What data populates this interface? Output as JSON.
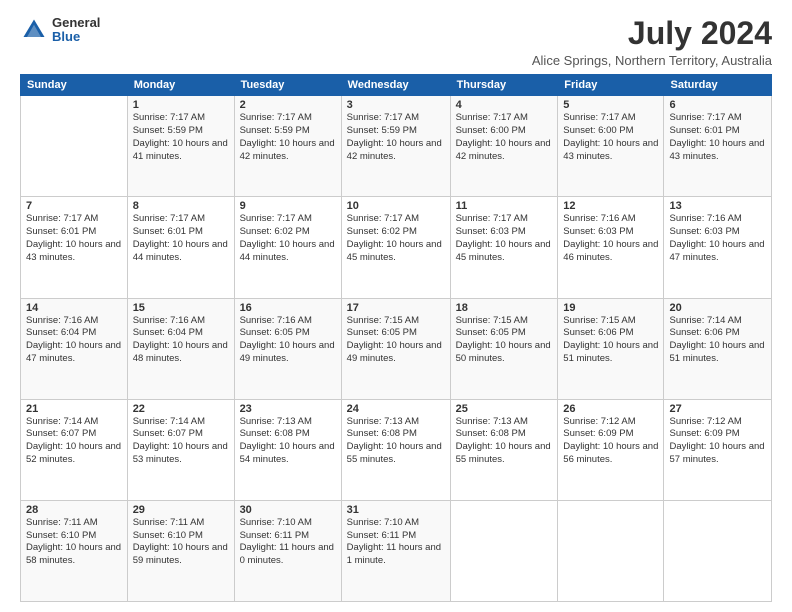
{
  "logo": {
    "general": "General",
    "blue": "Blue"
  },
  "title": "July 2024",
  "location": "Alice Springs, Northern Territory, Australia",
  "days_header": [
    "Sunday",
    "Monday",
    "Tuesday",
    "Wednesday",
    "Thursday",
    "Friday",
    "Saturday"
  ],
  "weeks": [
    [
      {
        "day": "",
        "sunrise": "",
        "sunset": "",
        "daylight": ""
      },
      {
        "day": "1",
        "sunrise": "Sunrise: 7:17 AM",
        "sunset": "Sunset: 5:59 PM",
        "daylight": "Daylight: 10 hours and 41 minutes."
      },
      {
        "day": "2",
        "sunrise": "Sunrise: 7:17 AM",
        "sunset": "Sunset: 5:59 PM",
        "daylight": "Daylight: 10 hours and 42 minutes."
      },
      {
        "day": "3",
        "sunrise": "Sunrise: 7:17 AM",
        "sunset": "Sunset: 5:59 PM",
        "daylight": "Daylight: 10 hours and 42 minutes."
      },
      {
        "day": "4",
        "sunrise": "Sunrise: 7:17 AM",
        "sunset": "Sunset: 6:00 PM",
        "daylight": "Daylight: 10 hours and 42 minutes."
      },
      {
        "day": "5",
        "sunrise": "Sunrise: 7:17 AM",
        "sunset": "Sunset: 6:00 PM",
        "daylight": "Daylight: 10 hours and 43 minutes."
      },
      {
        "day": "6",
        "sunrise": "Sunrise: 7:17 AM",
        "sunset": "Sunset: 6:01 PM",
        "daylight": "Daylight: 10 hours and 43 minutes."
      }
    ],
    [
      {
        "day": "7",
        "sunrise": "Sunrise: 7:17 AM",
        "sunset": "Sunset: 6:01 PM",
        "daylight": "Daylight: 10 hours and 43 minutes."
      },
      {
        "day": "8",
        "sunrise": "Sunrise: 7:17 AM",
        "sunset": "Sunset: 6:01 PM",
        "daylight": "Daylight: 10 hours and 44 minutes."
      },
      {
        "day": "9",
        "sunrise": "Sunrise: 7:17 AM",
        "sunset": "Sunset: 6:02 PM",
        "daylight": "Daylight: 10 hours and 44 minutes."
      },
      {
        "day": "10",
        "sunrise": "Sunrise: 7:17 AM",
        "sunset": "Sunset: 6:02 PM",
        "daylight": "Daylight: 10 hours and 45 minutes."
      },
      {
        "day": "11",
        "sunrise": "Sunrise: 7:17 AM",
        "sunset": "Sunset: 6:03 PM",
        "daylight": "Daylight: 10 hours and 45 minutes."
      },
      {
        "day": "12",
        "sunrise": "Sunrise: 7:16 AM",
        "sunset": "Sunset: 6:03 PM",
        "daylight": "Daylight: 10 hours and 46 minutes."
      },
      {
        "day": "13",
        "sunrise": "Sunrise: 7:16 AM",
        "sunset": "Sunset: 6:03 PM",
        "daylight": "Daylight: 10 hours and 47 minutes."
      }
    ],
    [
      {
        "day": "14",
        "sunrise": "Sunrise: 7:16 AM",
        "sunset": "Sunset: 6:04 PM",
        "daylight": "Daylight: 10 hours and 47 minutes."
      },
      {
        "day": "15",
        "sunrise": "Sunrise: 7:16 AM",
        "sunset": "Sunset: 6:04 PM",
        "daylight": "Daylight: 10 hours and 48 minutes."
      },
      {
        "day": "16",
        "sunrise": "Sunrise: 7:16 AM",
        "sunset": "Sunset: 6:05 PM",
        "daylight": "Daylight: 10 hours and 49 minutes."
      },
      {
        "day": "17",
        "sunrise": "Sunrise: 7:15 AM",
        "sunset": "Sunset: 6:05 PM",
        "daylight": "Daylight: 10 hours and 49 minutes."
      },
      {
        "day": "18",
        "sunrise": "Sunrise: 7:15 AM",
        "sunset": "Sunset: 6:05 PM",
        "daylight": "Daylight: 10 hours and 50 minutes."
      },
      {
        "day": "19",
        "sunrise": "Sunrise: 7:15 AM",
        "sunset": "Sunset: 6:06 PM",
        "daylight": "Daylight: 10 hours and 51 minutes."
      },
      {
        "day": "20",
        "sunrise": "Sunrise: 7:14 AM",
        "sunset": "Sunset: 6:06 PM",
        "daylight": "Daylight: 10 hours and 51 minutes."
      }
    ],
    [
      {
        "day": "21",
        "sunrise": "Sunrise: 7:14 AM",
        "sunset": "Sunset: 6:07 PM",
        "daylight": "Daylight: 10 hours and 52 minutes."
      },
      {
        "day": "22",
        "sunrise": "Sunrise: 7:14 AM",
        "sunset": "Sunset: 6:07 PM",
        "daylight": "Daylight: 10 hours and 53 minutes."
      },
      {
        "day": "23",
        "sunrise": "Sunrise: 7:13 AM",
        "sunset": "Sunset: 6:08 PM",
        "daylight": "Daylight: 10 hours and 54 minutes."
      },
      {
        "day": "24",
        "sunrise": "Sunrise: 7:13 AM",
        "sunset": "Sunset: 6:08 PM",
        "daylight": "Daylight: 10 hours and 55 minutes."
      },
      {
        "day": "25",
        "sunrise": "Sunrise: 7:13 AM",
        "sunset": "Sunset: 6:08 PM",
        "daylight": "Daylight: 10 hours and 55 minutes."
      },
      {
        "day": "26",
        "sunrise": "Sunrise: 7:12 AM",
        "sunset": "Sunset: 6:09 PM",
        "daylight": "Daylight: 10 hours and 56 minutes."
      },
      {
        "day": "27",
        "sunrise": "Sunrise: 7:12 AM",
        "sunset": "Sunset: 6:09 PM",
        "daylight": "Daylight: 10 hours and 57 minutes."
      }
    ],
    [
      {
        "day": "28",
        "sunrise": "Sunrise: 7:11 AM",
        "sunset": "Sunset: 6:10 PM",
        "daylight": "Daylight: 10 hours and 58 minutes."
      },
      {
        "day": "29",
        "sunrise": "Sunrise: 7:11 AM",
        "sunset": "Sunset: 6:10 PM",
        "daylight": "Daylight: 10 hours and 59 minutes."
      },
      {
        "day": "30",
        "sunrise": "Sunrise: 7:10 AM",
        "sunset": "Sunset: 6:11 PM",
        "daylight": "Daylight: 11 hours and 0 minutes."
      },
      {
        "day": "31",
        "sunrise": "Sunrise: 7:10 AM",
        "sunset": "Sunset: 6:11 PM",
        "daylight": "Daylight: 11 hours and 1 minute."
      },
      {
        "day": "",
        "sunrise": "",
        "sunset": "",
        "daylight": ""
      },
      {
        "day": "",
        "sunrise": "",
        "sunset": "",
        "daylight": ""
      },
      {
        "day": "",
        "sunrise": "",
        "sunset": "",
        "daylight": ""
      }
    ]
  ]
}
